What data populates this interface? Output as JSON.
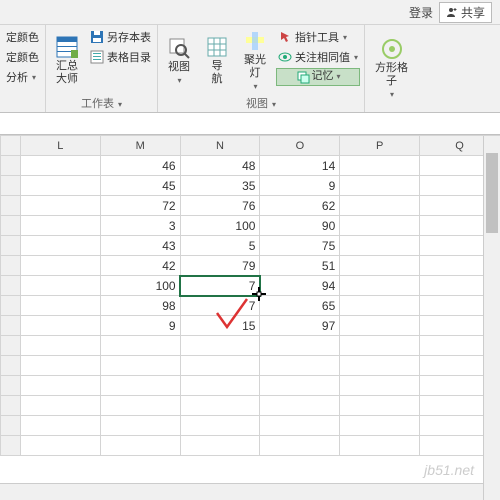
{
  "topbar": {
    "login": "登录",
    "share": "共享"
  },
  "ribbon": {
    "g1": {
      "a": "定颜色",
      "b": "定颜色",
      "c": "分析"
    },
    "g2": {
      "master": "汇总\n大师",
      "saveas": "另存本表",
      "toc": "表格目录",
      "label": "工作表"
    },
    "g3": {
      "view": "视图",
      "nav": "导\n航",
      "spot": "聚光\n灯",
      "pointer": "指针工具",
      "focus": "关注相同值",
      "memory": "记忆",
      "label": "视图"
    },
    "g4": {
      "cube": "方形格\n子"
    }
  },
  "chart_data": {
    "type": "table",
    "columns": [
      "L",
      "M",
      "N",
      "O",
      "P",
      "Q"
    ],
    "rows": [
      {
        "M": 46,
        "N": 48,
        "O": 14
      },
      {
        "M": 45,
        "N": 35,
        "O": 9
      },
      {
        "M": 72,
        "N": 76,
        "O": 62
      },
      {
        "M": 3,
        "N": 100,
        "O": 90
      },
      {
        "M": 43,
        "N": 5,
        "O": 75
      },
      {
        "M": 42,
        "N": 79,
        "O": 51
      },
      {
        "M": 100,
        "N": 7,
        "O": 94
      },
      {
        "M": 98,
        "N": 7,
        "O": 65
      },
      {
        "M": 9,
        "N": 15,
        "O": 97
      }
    ],
    "selected_cell": "N7",
    "selected_value": 7
  },
  "watermark": "jb51.net"
}
